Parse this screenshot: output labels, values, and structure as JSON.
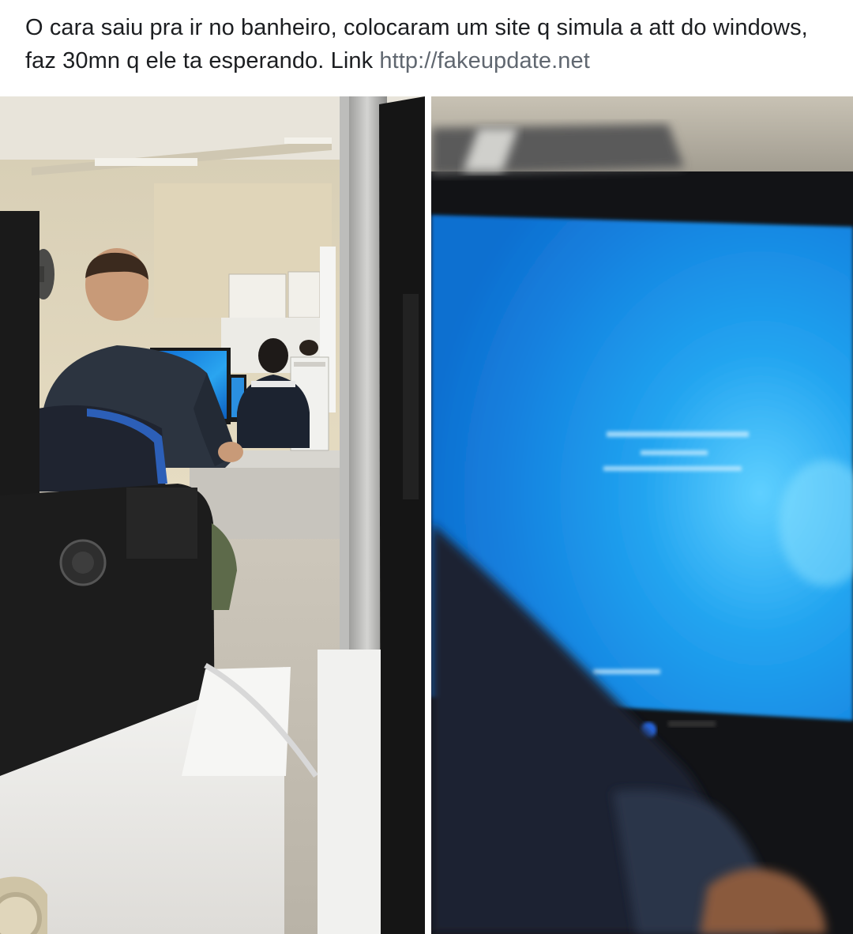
{
  "post": {
    "caption_text": "O cara saiu pra ir no banheiro, colocaram um site q simula a att do windows, faz 30mn q ele ta esperando. Link ",
    "link_text": "http://fakeupdate.net"
  },
  "colors": {
    "caption_text": "#1c1e21",
    "link_text": "#606770",
    "screen_blue": "#1a8fe8",
    "wall": "#e2d6b8"
  },
  "photos": [
    {
      "label": "classroom-photo",
      "depicts": "student at computer lab with blue Windows screen"
    },
    {
      "label": "monitor-closeup-photo",
      "depicts": "blurry close-up of blue Windows update screen"
    }
  ]
}
